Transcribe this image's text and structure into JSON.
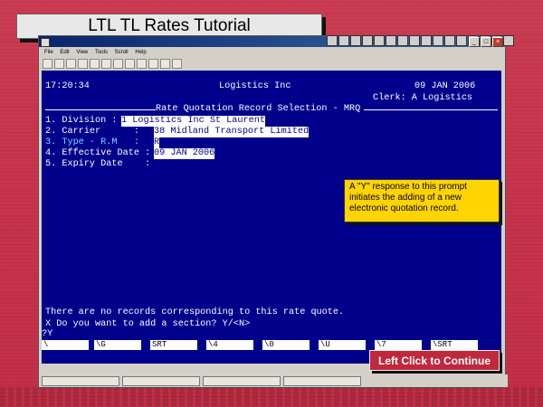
{
  "tutorial": {
    "title": "LTL TL Rates Tutorial",
    "callout_text": "A \"Y\" response to this prompt initiates the adding of a new electronic quotation record.",
    "continue_label": "Left Click to Continue"
  },
  "window": {
    "title": "",
    "menu": [
      "File",
      "Edit",
      "View",
      "Tools",
      "Scroll",
      "Help"
    ]
  },
  "terminal": {
    "time": "17:20:34",
    "company": "Logistics Inc",
    "date": "09 JAN 2006",
    "clerk": "Clerk: A Logistics",
    "screen_title": "Rate Quotation Record Selection - MRQ",
    "fields": [
      {
        "label": "1. Division :",
        "value": "1 Logistics Inc St Laurent"
      },
      {
        "label": "2. Carrier      :",
        "value": "38 Midland Transport Limited"
      },
      {
        "label": "3. Type - R.M   :",
        "value": "R"
      },
      {
        "label": "4. Effective Date :",
        "value": "09 JAN 2006"
      },
      {
        "label": "5. Expiry Date    :",
        "value": ""
      }
    ],
    "message": "There are no records corresponding to this rate quote.",
    "prompt": "X Do you want to add a section? Y/<N>",
    "input": "?Y",
    "function_keys": [
      "\\",
      "\\G",
      "SRT",
      "\\4",
      "\\0",
      "\\U",
      "\\7",
      "\\SRT"
    ]
  },
  "colors": {
    "background": "#c43249",
    "terminal": "#00008b",
    "callout": "#ffd400",
    "continue_button": "#c0283b"
  }
}
